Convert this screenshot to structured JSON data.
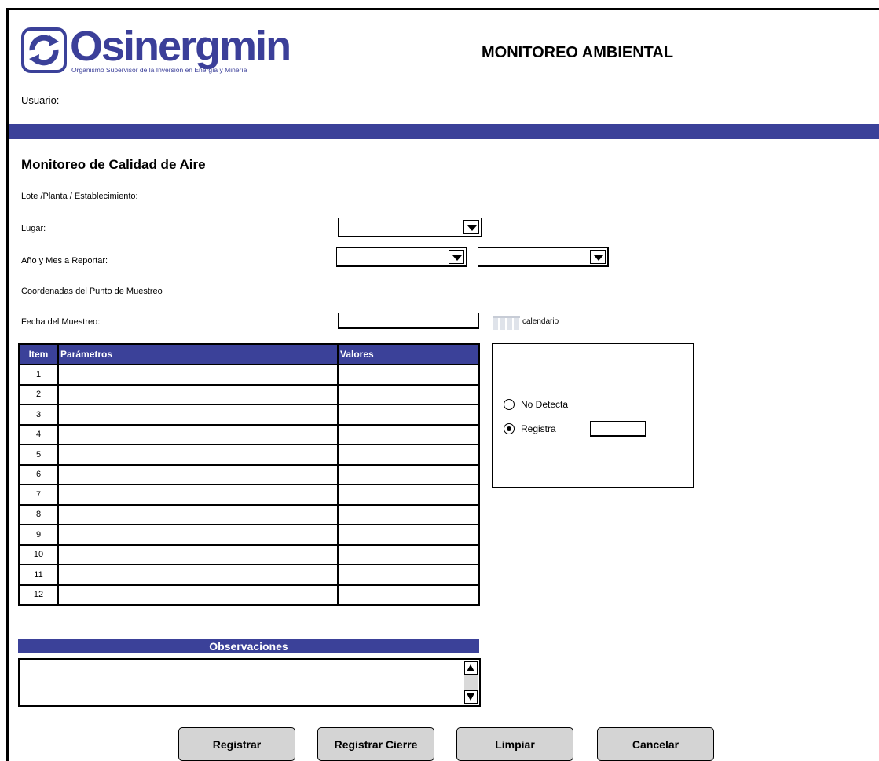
{
  "header": {
    "logo_text": "Osinergmin",
    "logo_subtitle": "Organismo Supervisor de la Inversión en Energía y Minería",
    "page_title": "MONITOREO AMBIENTAL",
    "user_label": "Usuario:",
    "brand_color": "#3b4199"
  },
  "form": {
    "section_title": "Monitoreo de Calidad de Aire",
    "lote_label": "Lote /Planta / Establecimiento:",
    "lugar_label": "Lugar:",
    "lugar_value": "",
    "periodo_label": "Año y Mes a Reportar:",
    "anio_value": "",
    "mes_value": "",
    "coordenadas_label": "Coordenadas del Punto de Muestreo",
    "fecha_label": "Fecha del Muestreo:",
    "fecha_value": "",
    "calendar_label": "calendario"
  },
  "table": {
    "headers": {
      "item": "Item",
      "parametros": "Parámetros",
      "valores": "Valores"
    },
    "rows": [
      {
        "item": "1",
        "parametro": "",
        "valor": ""
      },
      {
        "item": "2",
        "parametro": "",
        "valor": ""
      },
      {
        "item": "3",
        "parametro": "",
        "valor": ""
      },
      {
        "item": "4",
        "parametro": "",
        "valor": ""
      },
      {
        "item": "5",
        "parametro": "",
        "valor": ""
      },
      {
        "item": "6",
        "parametro": "",
        "valor": ""
      },
      {
        "item": "7",
        "parametro": "",
        "valor": ""
      },
      {
        "item": "8",
        "parametro": "",
        "valor": ""
      },
      {
        "item": "9",
        "parametro": "",
        "valor": ""
      },
      {
        "item": "10",
        "parametro": "",
        "valor": ""
      },
      {
        "item": "11",
        "parametro": "",
        "valor": ""
      },
      {
        "item": "12",
        "parametro": "",
        "valor": ""
      }
    ]
  },
  "detection": {
    "no_detecta_label": "No Detecta",
    "registra_label": "Registra",
    "selected": "Registra",
    "registra_value": ""
  },
  "observaciones": {
    "header": "Observaciones",
    "value": ""
  },
  "buttons": {
    "registrar": "Registrar",
    "registrar_cierre": "Registrar Cierre",
    "limpiar": "Limpiar",
    "cancelar": "Cancelar"
  }
}
